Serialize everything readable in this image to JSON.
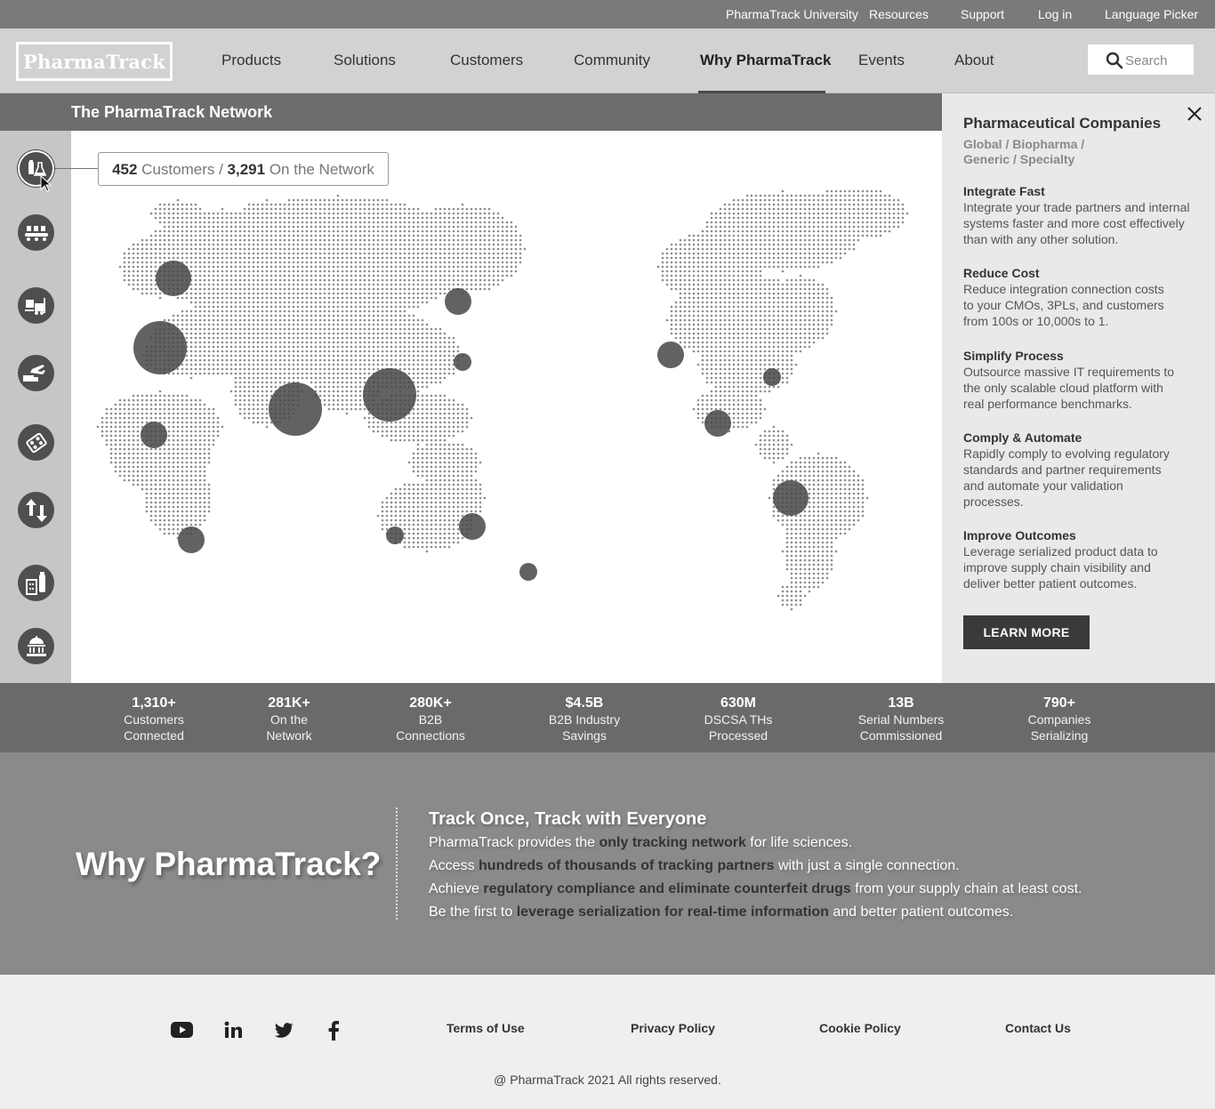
{
  "utility_nav": [
    "PharmaTrack University",
    "Resources",
    "Support",
    "Log in",
    "Language Picker"
  ],
  "brand": {
    "logo_text": "PharmaTrack"
  },
  "main_nav": {
    "items": [
      "Products",
      "Solutions",
      "Customers",
      "Community",
      "Why PharmaTrack",
      "Events",
      "About"
    ],
    "active": "Why PharmaTrack"
  },
  "search": {
    "placeholder": "Search"
  },
  "network": {
    "title": "The PharmaTrack Network",
    "counter": {
      "customers": "452",
      "customers_label": "Customers /",
      "network": "3,291",
      "network_label": "On the Network"
    },
    "categories": [
      "flask-bottle-icon",
      "factory-conveyor-icon",
      "forklift-truck-icon",
      "truck-plane-icon",
      "pill-blister-icon",
      "up-down-arrows-icon",
      "pharmacy-building-icon",
      "government-building-icon"
    ],
    "selected_category": "flask-bottle-icon"
  },
  "panel": {
    "title": "Pharmaceutical Companies",
    "segments": "Global / Biopharma / Generic / Specialty",
    "benefits": [
      {
        "title": "Integrate Fast",
        "desc": "Integrate your trade partners and internal systems faster and more cost effectively than with any other solution."
      },
      {
        "title": "Reduce Cost",
        "desc": "Reduce integration connection costs to your CMOs, 3PLs, and customers from 100s or 10,000s to 1."
      },
      {
        "title": "Simplify Process",
        "desc": "Outsource massive IT requirements to the only scalable cloud platform with real performance benchmarks."
      },
      {
        "title": "Comply & Automate",
        "desc": "Rapidly comply to evolving regulatory standards and partner requirements and automate your validation processes."
      },
      {
        "title": "Improve Outcomes",
        "desc": "Leverage serialized product data to improve supply chain visibility and deliver better patient outcomes."
      }
    ],
    "cta": "LEARN MORE"
  },
  "stats": [
    {
      "value": "1,310+",
      "line1": "Customers",
      "line2": "Connected"
    },
    {
      "value": "281K+",
      "line1": "On the",
      "line2": "Network"
    },
    {
      "value": "280K+",
      "line1": "B2B",
      "line2": "Connections"
    },
    {
      "value": "$4.5B",
      "line1": "B2B Industry",
      "line2": "Savings"
    },
    {
      "value": "630M",
      "line1": "DSCSA THs",
      "line2": "Processed"
    },
    {
      "value": "13B",
      "line1": "Serial Numbers",
      "line2": "Commissioned"
    },
    {
      "value": "790+",
      "line1": "Companies",
      "line2": "Serializing"
    }
  ],
  "why": {
    "heading": "Why PharmaTrack?",
    "subheading": "Track Once, Track with Everyone",
    "lines": [
      {
        "pre": "PharmaTrack provides the ",
        "bold": "only tracking network",
        "post": " for life sciences."
      },
      {
        "pre": "Access ",
        "bold": "hundreds of thousands of tracking partners",
        "post": " with just a single connection."
      },
      {
        "pre": "Achieve ",
        "bold": "regulatory compliance and eliminate counterfeit drugs",
        "post": " from your supply chain at least cost."
      },
      {
        "pre": "Be the first to ",
        "bold": "leverage serialization for real-time information",
        "post": " and better patient outcomes."
      }
    ]
  },
  "footer": {
    "social": [
      "youtube-icon",
      "linkedin-icon",
      "twitter-icon",
      "facebook-icon"
    ],
    "links": [
      "Terms of Use",
      "Privacy Policy",
      "Cookie Policy",
      "Contact Us"
    ],
    "copyright": "@ PharmaTrack 2021 All rights reserved."
  }
}
